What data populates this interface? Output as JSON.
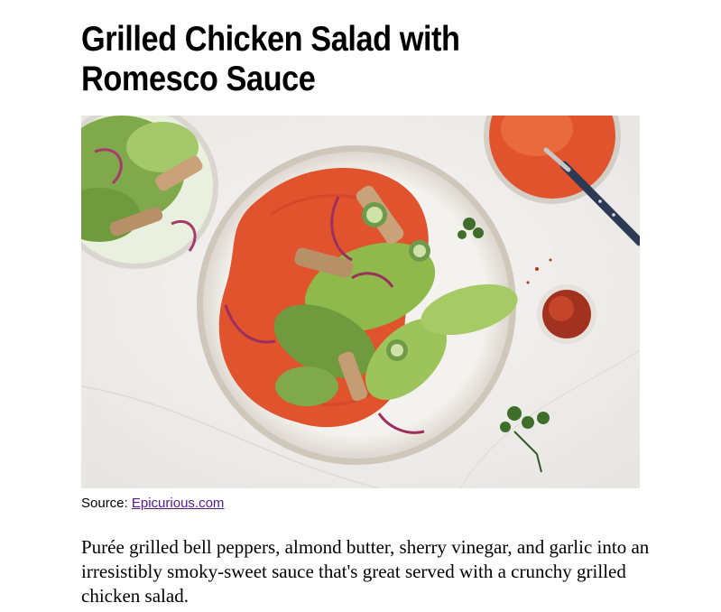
{
  "recipe": {
    "title": "Grilled Chicken Salad with Romesco Sauce",
    "source_label": "Source:",
    "source_link": "Epicurious.com",
    "description": "Purée grilled bell peppers, almond butter, sherry vinegar, and garlic into an irresistibly smoky-sweet sauce that's great served with a crunchy grilled chicken salad."
  },
  "colors": {
    "link": "#551a8b",
    "sauce": "#e0532c",
    "lettuce": "#8fb94a",
    "marble": "#f1f0ee"
  }
}
